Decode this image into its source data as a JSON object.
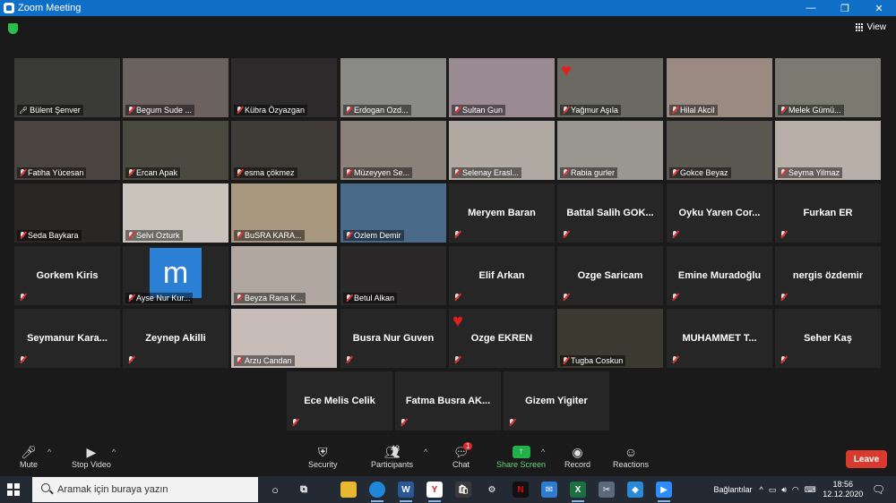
{
  "window": {
    "title": "Zoom Meeting"
  },
  "top": {
    "view_label": "View"
  },
  "tiles": [
    {
      "name": "Bülent Şenver",
      "video": true,
      "active": true,
      "mic_off": false,
      "bg": "#3a3a36"
    },
    {
      "name": "Begum Sude ...",
      "video": true,
      "mic_off": true,
      "bg": "#6b6260"
    },
    {
      "name": "Kübra Özyazgan",
      "video": true,
      "mic_off": true,
      "bg": "#2c2a2a"
    },
    {
      "name": "Erdogan Ozd...",
      "video": true,
      "mic_off": true,
      "bg": "#8a8a86"
    },
    {
      "name": "Sultan Gun",
      "video": true,
      "mic_off": true,
      "bg": "#9a8a92"
    },
    {
      "name": "Yağmur Aşıla",
      "video": true,
      "mic_off": true,
      "bg": "#6a6a62",
      "heart": true
    },
    {
      "name": "Hilal Akcil",
      "video": true,
      "mic_off": true,
      "bg": "#9a8a82"
    },
    {
      "name": "Melek Gümü...",
      "video": true,
      "mic_off": true,
      "bg": "#7a7a70"
    },
    {
      "name": "Fatiha Yücesan",
      "video": true,
      "mic_off": true,
      "bg": "#4a4440"
    },
    {
      "name": "Ercan Apak",
      "video": true,
      "mic_off": true,
      "bg": "#4a4a40"
    },
    {
      "name": "esma çökmez",
      "video": true,
      "mic_off": true,
      "bg": "#3e3a36"
    },
    {
      "name": "Müzeyyen Se...",
      "video": true,
      "mic_off": true,
      "bg": "#8a8278"
    },
    {
      "name": "Selenay Erasl...",
      "video": true,
      "mic_off": true,
      "bg": "#b0aaa2"
    },
    {
      "name": "Rabia gurler",
      "video": true,
      "mic_off": true,
      "bg": "#9a9690"
    },
    {
      "name": "Gokce Beyaz",
      "video": true,
      "mic_off": true,
      "bg": "#5a5650"
    },
    {
      "name": "Seyma Yilmaz",
      "video": true,
      "mic_off": true,
      "bg": "#b8b0a8"
    },
    {
      "name": "Seda Baykara",
      "video": true,
      "mic_off": true,
      "bg": "#2a2624"
    },
    {
      "name": "Selvi Ozturk",
      "video": true,
      "mic_off": true,
      "bg": "#c8c4bc"
    },
    {
      "name": "BuSRA KARA...",
      "video": true,
      "mic_off": true,
      "bg": "#a89880"
    },
    {
      "name": "Ozlem Demir",
      "video": true,
      "mic_off": true,
      "bg": "#4a6a8a"
    },
    {
      "name": "Meryem Baran",
      "video": false,
      "mic_off": true
    },
    {
      "name": "Battal Salih GOK...",
      "video": false,
      "mic_off": true
    },
    {
      "name": "Oyku Yaren Cor...",
      "video": false,
      "mic_off": true
    },
    {
      "name": "Furkan ER",
      "video": false,
      "mic_off": true
    },
    {
      "name": "Gorkem Kiris",
      "video": false,
      "mic_off": true
    },
    {
      "name": "Ayse Nur Kur...",
      "video": true,
      "mic_off": true,
      "bg": "#262626",
      "logo": "m"
    },
    {
      "name": "Beyza Rana K...",
      "video": true,
      "mic_off": true,
      "bg": "#b0a8a0"
    },
    {
      "name": "Betul Alkan",
      "video": true,
      "mic_off": true,
      "bg": "#2a2828"
    },
    {
      "name": "Elif Arkan",
      "video": false,
      "mic_off": true
    },
    {
      "name": "Ozge Saricam",
      "video": false,
      "mic_off": true
    },
    {
      "name": "Emine Muradoğlu",
      "video": false,
      "mic_off": true
    },
    {
      "name": "nergis özdemir",
      "video": false,
      "mic_off": true
    },
    {
      "name": "Seymanur Kara...",
      "video": false,
      "mic_off": true
    },
    {
      "name": "Zeynep Akilli",
      "video": false,
      "mic_off": true
    },
    {
      "name": "Arzu Candan",
      "video": true,
      "mic_off": true,
      "bg": "#c8bcb8"
    },
    {
      "name": "Busra Nur Guven",
      "video": false,
      "mic_off": true
    },
    {
      "name": "Ozge EKREN",
      "video": false,
      "mic_off": true,
      "heart": true
    },
    {
      "name": "Tugba Coskun",
      "video": true,
      "mic_off": true,
      "bg": "#3a3a30"
    },
    {
      "name": "MUHAMMET T...",
      "video": false,
      "mic_off": true
    },
    {
      "name": "Seher Kaş",
      "video": false,
      "mic_off": true
    },
    {
      "name": "Ece Melis Celik",
      "video": false,
      "mic_off": true
    },
    {
      "name": "Fatma Busra AK...",
      "video": false,
      "mic_off": true
    },
    {
      "name": "Gizem Yigiter",
      "video": false,
      "mic_off": true
    }
  ],
  "toolbar": {
    "mute": "Mute",
    "stop_video": "Stop Video",
    "security": "Security",
    "participants": "Participants",
    "participants_count": "43",
    "chat": "Chat",
    "chat_badge": "1",
    "share_screen": "Share Screen",
    "record": "Record",
    "reactions": "Reactions",
    "leave": "Leave"
  },
  "taskbar": {
    "search_placeholder": "Aramak için buraya yazın",
    "tray_label": "Bağlantılar",
    "time": "18:56",
    "date": "12.12.2020"
  }
}
